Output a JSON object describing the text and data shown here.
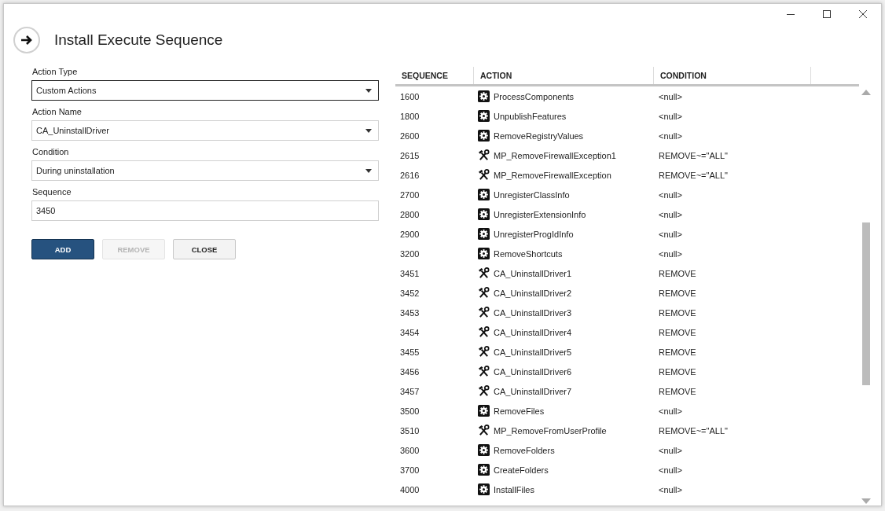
{
  "window": {
    "title": "Install Execute Sequence"
  },
  "form": {
    "fields": [
      {
        "label": "Action Type",
        "kind": "dropdown",
        "value": "Custom Actions",
        "focused": true
      },
      {
        "label": "Action Name",
        "kind": "dropdown",
        "value": "CA_UninstallDriver",
        "focused": false
      },
      {
        "label": "Condition",
        "kind": "dropdown",
        "value": "During uninstallation",
        "focused": false
      },
      {
        "label": "Sequence",
        "kind": "text",
        "value": "3450",
        "focused": false
      }
    ],
    "buttons": [
      {
        "label": "ADD",
        "kind": "primary",
        "disabled": false
      },
      {
        "label": "REMOVE",
        "kind": "secondary",
        "disabled": true
      },
      {
        "label": "CLOSE",
        "kind": "secondary",
        "disabled": false
      }
    ]
  },
  "table": {
    "columns": [
      "SEQUENCE",
      "ACTION",
      "CONDITION"
    ],
    "rows": [
      {
        "sequence": "1600",
        "kind": "standard",
        "action": "ProcessComponents",
        "condition": "<null>"
      },
      {
        "sequence": "1800",
        "kind": "standard",
        "action": "UnpublishFeatures",
        "condition": "<null>"
      },
      {
        "sequence": "2600",
        "kind": "standard",
        "action": "RemoveRegistryValues",
        "condition": "<null>"
      },
      {
        "sequence": "2615",
        "kind": "custom",
        "action": "MP_RemoveFirewallException1",
        "condition": "REMOVE~=\"ALL\""
      },
      {
        "sequence": "2616",
        "kind": "custom",
        "action": "MP_RemoveFirewallException",
        "condition": "REMOVE~=\"ALL\""
      },
      {
        "sequence": "2700",
        "kind": "standard",
        "action": "UnregisterClassInfo",
        "condition": "<null>"
      },
      {
        "sequence": "2800",
        "kind": "standard",
        "action": "UnregisterExtensionInfo",
        "condition": "<null>"
      },
      {
        "sequence": "2900",
        "kind": "standard",
        "action": "UnregisterProgIdInfo",
        "condition": "<null>"
      },
      {
        "sequence": "3200",
        "kind": "standard",
        "action": "RemoveShortcuts",
        "condition": "<null>"
      },
      {
        "sequence": "3451",
        "kind": "custom",
        "action": "CA_UninstallDriver1",
        "condition": "REMOVE"
      },
      {
        "sequence": "3452",
        "kind": "custom",
        "action": "CA_UninstallDriver2",
        "condition": "REMOVE"
      },
      {
        "sequence": "3453",
        "kind": "custom",
        "action": "CA_UninstallDriver3",
        "condition": "REMOVE"
      },
      {
        "sequence": "3454",
        "kind": "custom",
        "action": "CA_UninstallDriver4",
        "condition": "REMOVE"
      },
      {
        "sequence": "3455",
        "kind": "custom",
        "action": "CA_UninstallDriver5",
        "condition": "REMOVE"
      },
      {
        "sequence": "3456",
        "kind": "custom",
        "action": "CA_UninstallDriver6",
        "condition": "REMOVE"
      },
      {
        "sequence": "3457",
        "kind": "custom",
        "action": "CA_UninstallDriver7",
        "condition": "REMOVE"
      },
      {
        "sequence": "3500",
        "kind": "standard",
        "action": "RemoveFiles",
        "condition": "<null>"
      },
      {
        "sequence": "3510",
        "kind": "custom",
        "action": "MP_RemoveFromUserProfile",
        "condition": "REMOVE~=\"ALL\""
      },
      {
        "sequence": "3600",
        "kind": "standard",
        "action": "RemoveFolders",
        "condition": "<null>"
      },
      {
        "sequence": "3700",
        "kind": "standard",
        "action": "CreateFolders",
        "condition": "<null>"
      },
      {
        "sequence": "4000",
        "kind": "standard",
        "action": "InstallFiles",
        "condition": "<null>"
      }
    ]
  }
}
